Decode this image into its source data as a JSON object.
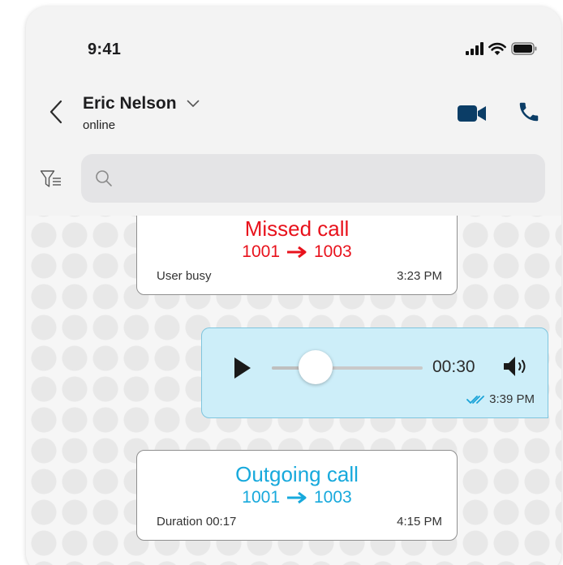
{
  "status_bar": {
    "time": "9:41",
    "icons": [
      "signal-icon",
      "wifi-icon",
      "battery-icon"
    ]
  },
  "header": {
    "contact_name": "Eric Nelson",
    "contact_status": "online",
    "icons": [
      "back-icon",
      "chevron-down-icon",
      "video-icon",
      "phone-icon"
    ],
    "accent_color": "#0b3d66"
  },
  "search": {
    "value": "",
    "placeholder": "",
    "icons": [
      "filter-icon",
      "search-icon"
    ]
  },
  "messages": [
    {
      "kind": "call",
      "title": "Missed call",
      "from": "1001",
      "to": "1003",
      "note": "User busy",
      "time": "3:23 PM",
      "color": "#e8121c"
    },
    {
      "kind": "voice",
      "duration": "00:30",
      "progress": 0.29,
      "time": "3:39 PM",
      "status": "read",
      "icons": [
        "play-icon",
        "volume-icon",
        "double-check-icon"
      ]
    },
    {
      "kind": "call",
      "title": "Outgoing call",
      "from": "1001",
      "to": "1003",
      "note": "Duration 00:17",
      "time": "4:15 PM",
      "color": "#17a9dc"
    }
  ]
}
